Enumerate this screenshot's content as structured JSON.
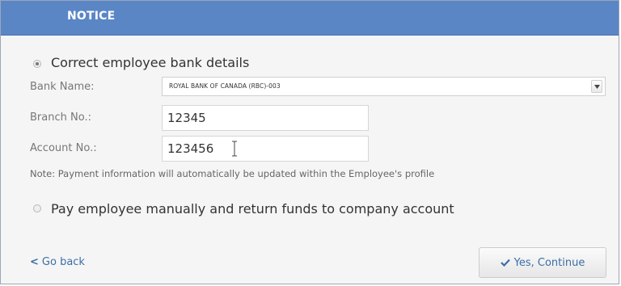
{
  "dialog": {
    "title": "NOTICE"
  },
  "options": {
    "correct_details": {
      "label": "Correct employee bank details",
      "selected": true
    },
    "pay_manually": {
      "label": "Pay employee manually and return funds to company account",
      "selected": false
    }
  },
  "form": {
    "bank_name_label": "Bank Name:",
    "bank_name_value": "ROYAL BANK OF CANADA (RBC)-003",
    "branch_label": "Branch No.:",
    "branch_value": "12345",
    "account_label": "Account No.:",
    "account_value": "123456",
    "note": "Note: Payment information will automatically be updated within the Employee's profile"
  },
  "footer": {
    "back_label": "Go back",
    "continue_label": "Yes, Continue"
  },
  "icons": {
    "back": "chevron-left-icon",
    "continue": "checkmark-icon",
    "dropdown": "caret-down-icon",
    "cursor": "text-cursor-icon"
  },
  "colors": {
    "header_bg": "#5a86c6",
    "link": "#3b6ea5",
    "dialog_bg": "#f5f5f5"
  }
}
